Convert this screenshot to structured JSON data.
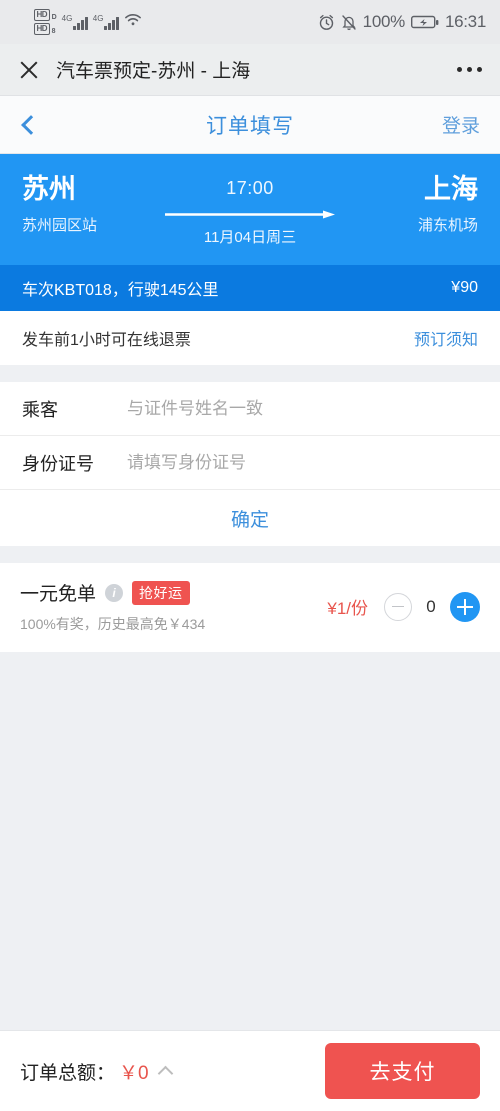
{
  "statusbar": {
    "network_badges": [
      "HD",
      "HD"
    ],
    "network_sub": [
      "D",
      "8"
    ],
    "signal_labels": [
      "4G",
      "4G"
    ],
    "wifi_icon": "wifi-icon",
    "alarm_icon": "alarm-clock-icon",
    "mute_icon": "bell-muted-icon",
    "battery_percent": "100%",
    "battery_icon": "battery-charging-icon",
    "time": "16:31"
  },
  "titlebar": {
    "close_icon": "close-icon",
    "title": "汽车票预定-苏州 - 上海",
    "more_icon": "more-options-icon"
  },
  "navbar": {
    "back_icon": "back-chevron-icon",
    "title": "订单填写",
    "login_label": "登录"
  },
  "route": {
    "from_city": "苏州",
    "from_station": "苏州园区站",
    "depart_time": "17:00",
    "depart_date": "11月04日周三",
    "to_city": "上海",
    "to_station": "浦东机场",
    "trip_info": "车次KBT018，行驶145公里",
    "trip_price": "¥90",
    "card_color": "#2196f3",
    "trip_bar_color": "#0b7ae0"
  },
  "refund": {
    "text": "发车前1小时可在线退票",
    "link_label": "预订须知"
  },
  "form": {
    "rows": [
      {
        "label": "乘客",
        "value": "",
        "placeholder": "与证件号姓名一致"
      },
      {
        "label": "身份证号",
        "value": "",
        "placeholder": "请填写身份证号"
      }
    ],
    "confirm_label": "确定"
  },
  "promo": {
    "title": "一元免单",
    "info_icon": "info-icon",
    "badge": "抢好运",
    "subtitle": "100%有奖，历史最高免￥434",
    "price": "¥1/份",
    "quantity": "0",
    "minus_icon": "minus-icon",
    "plus_icon": "plus-icon",
    "badge_color": "#ef5350",
    "price_color": "#e8554d"
  },
  "bottombar": {
    "total_label": "订单总额：",
    "total_amount": "￥0",
    "expand_icon": "chevron-up-icon",
    "pay_label": "去支付",
    "pay_color": "#ef5350"
  }
}
